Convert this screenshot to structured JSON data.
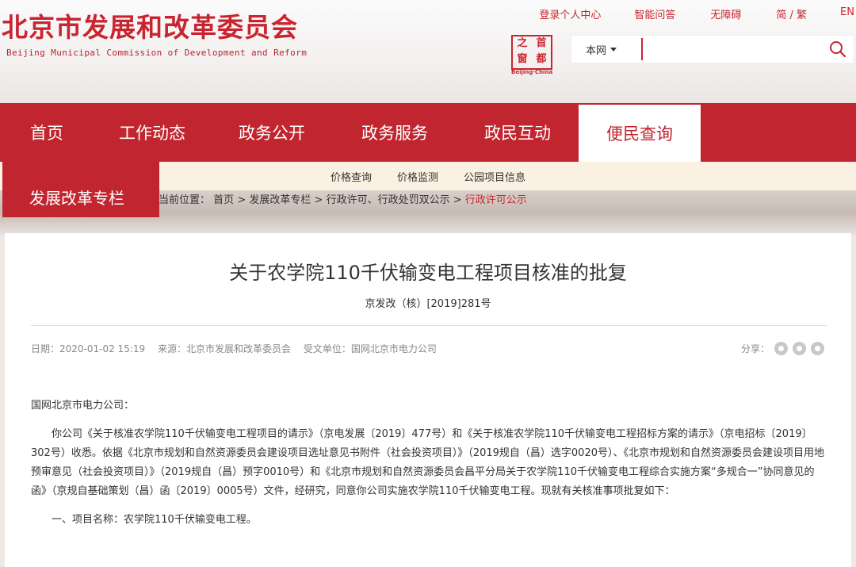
{
  "header": {
    "site_name_cn": "北京市发展和改革委员会",
    "site_name_en": "Beijing Municipal Commission of Development and Reform",
    "top_links": [
      "登录个人中心",
      "智能问答",
      "无障碍",
      "简 / 繁",
      "EN"
    ],
    "seal_chars": [
      "之",
      "首",
      "窗",
      "都"
    ],
    "seal_caption": "Beijing·China",
    "search": {
      "scope": "本网",
      "value": "",
      "placeholder": ""
    },
    "accent_color": "#c1252f"
  },
  "nav": {
    "items": [
      "首页",
      "工作动态",
      "政务公开",
      "政务服务",
      "政民互动",
      "便民查询"
    ],
    "active": "便民查询",
    "sub_items": [
      "价格查询",
      "价格监测",
      "公园项目信息"
    ],
    "side_tab": "发展改革专栏"
  },
  "breadcrumb": {
    "label": "当前位置：",
    "items": [
      "首页",
      "发展改革专栏",
      "行政许可、行政处罚双公示"
    ],
    "sep": ">",
    "current": "行政许可公示"
  },
  "article": {
    "title": "关于农学院110千伏输变电工程项目核准的批复",
    "doc_no": "京发改（核）[2019]281号",
    "date": "日期：2020-01-02 15:19",
    "source": "来源：北京市发展和改革委员会",
    "recipient": "受文单位：国网北京市电力公司",
    "share_label": "分享：",
    "salutation": "国网北京市电力公司：",
    "body": "你公司《关于核准农学院110千伏输变电工程项目的请示》（京电发展〔2019〕477号）和《关于核准农学院110千伏输变电工程招标方案的请示》（京电招标〔2019〕302号）收悉。依据《北京市规划和自然资源委员会建设项目选址意见书附件（社会投资项目）》（2019规自（昌）选字0020号）、《北京市规划和自然资源委员会建设项目用地预审意见（社会投资项目）》（2019规自（昌）预字0010号）和《北京市规划和自然资源委员会昌平分局关于农学院110千伏输变电工程综合实施方案“多规合一”协同意见的函》（京规自基础策划（昌）函〔2019〕0005号）文件，经研究，同意你公司实施农学院110千伏输变电工程。现就有关核准事项批复如下：",
    "item1": "一、项目名称：农学院110千伏输变电工程。"
  }
}
